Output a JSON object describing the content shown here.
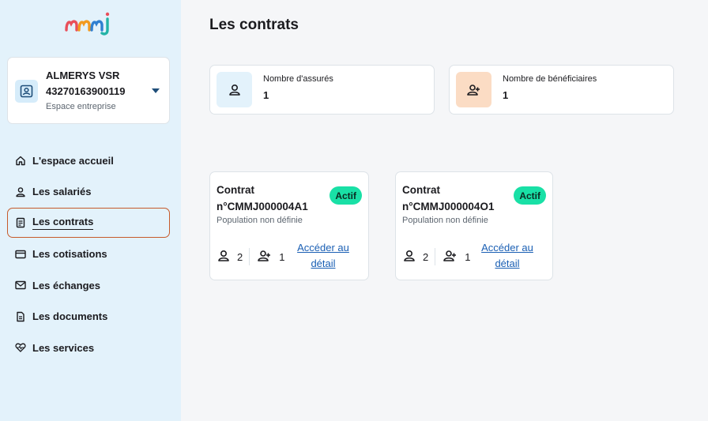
{
  "brand": {
    "logo_text": "mmj",
    "accent": "#c65a2a"
  },
  "account": {
    "name": "ALMERYS VSR",
    "id": "43270163900119",
    "subtitle": "Espace entreprise",
    "icon": "id-card-icon",
    "toggle_icon": "caret-down-icon"
  },
  "nav": [
    {
      "label": "L'espace accueil",
      "icon": "home-icon"
    },
    {
      "label": "Les salariés",
      "icon": "user-icon"
    },
    {
      "label": "Les contrats",
      "icon": "document-list-icon",
      "active": true
    },
    {
      "label": "Les cotisations",
      "icon": "credit-card-icon"
    },
    {
      "label": "Les échanges",
      "icon": "mail-icon"
    },
    {
      "label": "Les documents",
      "icon": "file-icon"
    },
    {
      "label": "Les services",
      "icon": "heart-pulse-icon"
    }
  ],
  "main": {
    "title": "Les contrats",
    "stats": [
      {
        "label": "Nombre d'assurés",
        "value": "1",
        "icon": "user-icon",
        "bg": "#e3f2fb"
      },
      {
        "label": "Nombre de bénéficiaires",
        "value": "1",
        "icon": "users-icon",
        "bg": "#fbdcc4"
      }
    ],
    "contracts": [
      {
        "line1": "Contrat",
        "line2": "n°CMMJ000004A1",
        "badge": "Actif",
        "population": "Population non définie",
        "insured": "2",
        "beneficiaries": "1",
        "link_line1": "Accéder au",
        "link_line2": "détail"
      },
      {
        "line1": "Contrat",
        "line2": "n°CMMJ000004O1",
        "badge": "Actif",
        "population": "Population non définie",
        "insured": "2",
        "beneficiaries": "1",
        "link_line1": "Accéder au",
        "link_line2": "détail"
      }
    ]
  }
}
